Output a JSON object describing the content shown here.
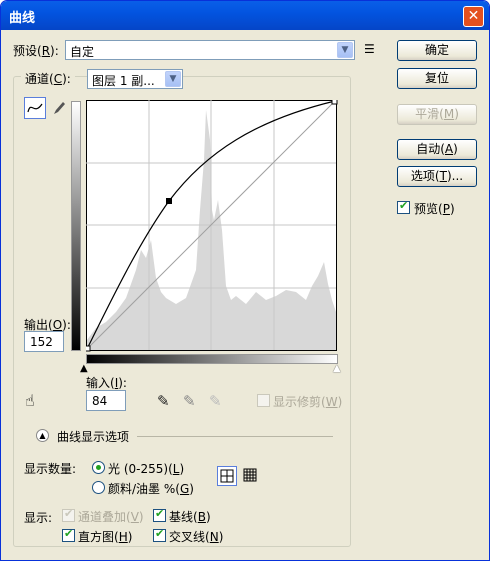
{
  "title": "曲线",
  "preset": {
    "label": "预设",
    "key": "R",
    "value": "自定"
  },
  "channel": {
    "label": "通道",
    "key": "C",
    "value": "图层 1 副..."
  },
  "output": {
    "label": "输出",
    "key": "O",
    "value": "152"
  },
  "input": {
    "label": "输入",
    "key": "I",
    "value": "84"
  },
  "show_clipping": {
    "label": "显示修剪",
    "key": "W",
    "checked": false
  },
  "curve_options": {
    "label": "曲线显示选项"
  },
  "buttons": {
    "ok": {
      "label": "确定"
    },
    "reset": {
      "label": "复位"
    },
    "smooth": {
      "label": "平滑",
      "key": "M"
    },
    "auto": {
      "label": "自动",
      "key": "A"
    },
    "options": {
      "label": "选项",
      "key": "T",
      "suffix": "..."
    }
  },
  "preview": {
    "label": "预览",
    "key": "P",
    "checked": true
  },
  "show_amount": {
    "label": "显示数量:",
    "light": {
      "label": "光 (0-255)",
      "key": "L",
      "selected": true
    },
    "pigment": {
      "label": "颜料/油墨 %",
      "key": "G",
      "selected": false
    }
  },
  "show": {
    "label": "显示:",
    "channel_overlays": {
      "label": "通道叠加",
      "key": "V",
      "checked": true,
      "disabled": true
    },
    "baseline": {
      "label": "基线",
      "key": "B",
      "checked": true
    },
    "histogram": {
      "label": "直方图",
      "key": "H",
      "checked": true
    },
    "intersection": {
      "label": "交叉线",
      "key": "N",
      "checked": true
    }
  },
  "curve": {
    "input_max": 255,
    "output_max": 255,
    "control_point": {
      "input": 84,
      "output": 152
    }
  },
  "colors": {
    "title_bar": "#0554e1",
    "dialog_bg": "#ece9d8",
    "histogram": "#d8d8d8"
  }
}
